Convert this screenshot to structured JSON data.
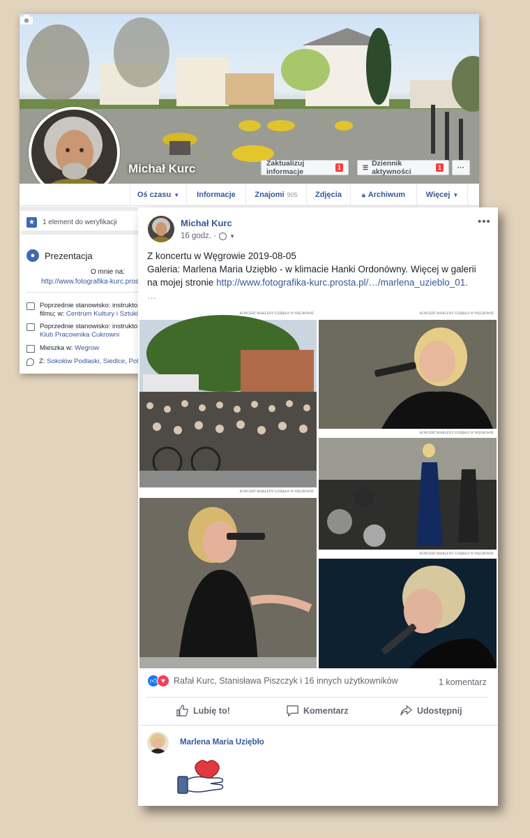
{
  "profile": {
    "name": "Michał Kurc",
    "update_info_label": "Zaktualizuj informacje",
    "update_info_badge": "1",
    "activity_log_label": "Dziennik aktywności",
    "activity_log_badge": "1",
    "more_dots": "···",
    "tabs": [
      {
        "label": "Oś czasu"
      },
      {
        "label": "Informacje"
      },
      {
        "label": "Znajomi",
        "count": "905"
      },
      {
        "label": "Zdjęcia"
      },
      {
        "label": "Archiwum"
      },
      {
        "label": "Więcej"
      }
    ],
    "verification_text": "1 element do weryfikacji",
    "intro_title": "Prezentacja",
    "about_label": "O mnie na:",
    "about_link": "http://www.fotografika-kurc.prosta.pl",
    "details": [
      {
        "line1": "Poprzednie stanowisko: instruktor",
        "line2_prefix": "filmu; w: ",
        "line2_link": "Centrum Kultury i Sztuki w"
      },
      {
        "line1": "Poprzednie stanowisko: instruktor",
        "line2_link": "Klub Pracownika Cukrowni"
      },
      {
        "prefix": "Mieszka w: ",
        "link": "Wegrow"
      },
      {
        "prefix": "Z: ",
        "link": "Sokołów Podlaski, Siedlce, Pola"
      }
    ]
  },
  "post": {
    "author": "Michał Kurc",
    "time": "16 godz. ·",
    "more": "•••",
    "text_line1": "Z koncertu w Węgrowie 2019-08-05",
    "text_line2": "Galeria: Marlena Maria Uziębło - w klimacie Hanki Ordonówny. Więcej w galerii na mojej stronie ",
    "text_link": "http://www.fotografika-kurc.prosta.pl/…/marlena_uzieblo_01.",
    "text_ellipsis": "…",
    "photo_caption": "KONCERT MARLENY UZIĘBŁO W WĘGROWIE",
    "reactions_text": "Rafał Kurc, Stanisława Piszczyk i 16 innych użytkowników",
    "comment_count": "1 komentarz",
    "actions": {
      "like": "Lubię to!",
      "comment": "Komentarz",
      "share": "Udostępnij"
    },
    "commenter": "Marlena Maria Uziębło"
  },
  "colors": {
    "link": "#365899",
    "accent": "#4267b2",
    "background": "#e2d3bd"
  }
}
